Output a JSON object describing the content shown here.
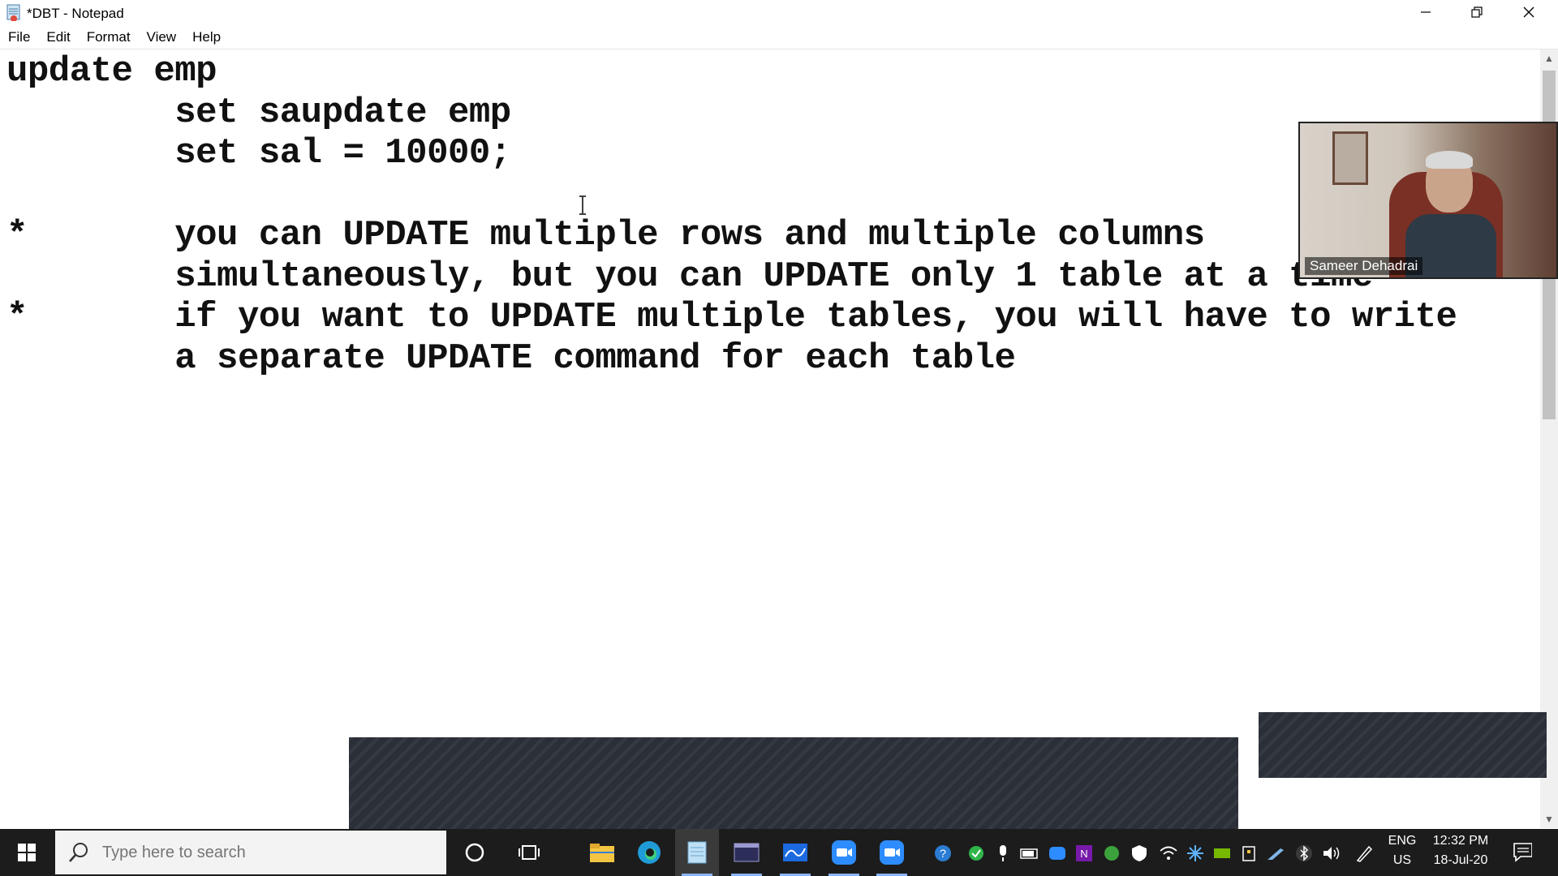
{
  "window": {
    "title": "*DBT - Notepad",
    "minimize_label": "—",
    "maximize_label": "⧉",
    "close_label": "✕"
  },
  "menu": [
    "File",
    "Edit",
    "Format",
    "View",
    "Help"
  ],
  "editor": {
    "lines": [
      "update emp",
      "        set saupdate emp",
      "        set sal = 10000;",
      "",
      "*       you can UPDATE multiple rows and multiple columns",
      "        simultaneously, but you can UPDATE only 1 table at a time",
      "*       if you want to UPDATE multiple tables, you will have to write",
      "        a separate UPDATE command for each table"
    ]
  },
  "video": {
    "participant_name": "Sameer Dehadrai"
  },
  "taskbar": {
    "search_placeholder": "Type here to search",
    "language_primary": "ENG",
    "language_secondary": "US",
    "time": "12:32 PM",
    "date": "18-Jul-20",
    "apps": [
      "cortana-icon",
      "task-view-icon",
      "file-explorer-icon",
      "edge-icon",
      "notepad-icon",
      "terminal-icon",
      "whiteboard-icon",
      "zoom-icon",
      "zoom-meetings-icon"
    ],
    "tray": [
      "help-icon",
      "check-shield-icon",
      "microphone-icon",
      "battery-icon",
      "zoom-tray-icon",
      "onenote-icon",
      "update-icon",
      "defender-icon",
      "wifi-icon",
      "snowflake-icon",
      "nvidia-icon",
      "usb-icon",
      "pen-icon",
      "bluetooth-icon",
      "volume-icon",
      "ink-workspace-icon"
    ]
  },
  "colors": {
    "taskbar_bg": "#1c1c1c",
    "overlay": "#2a2f38",
    "accent": "#8ab4f8"
  }
}
